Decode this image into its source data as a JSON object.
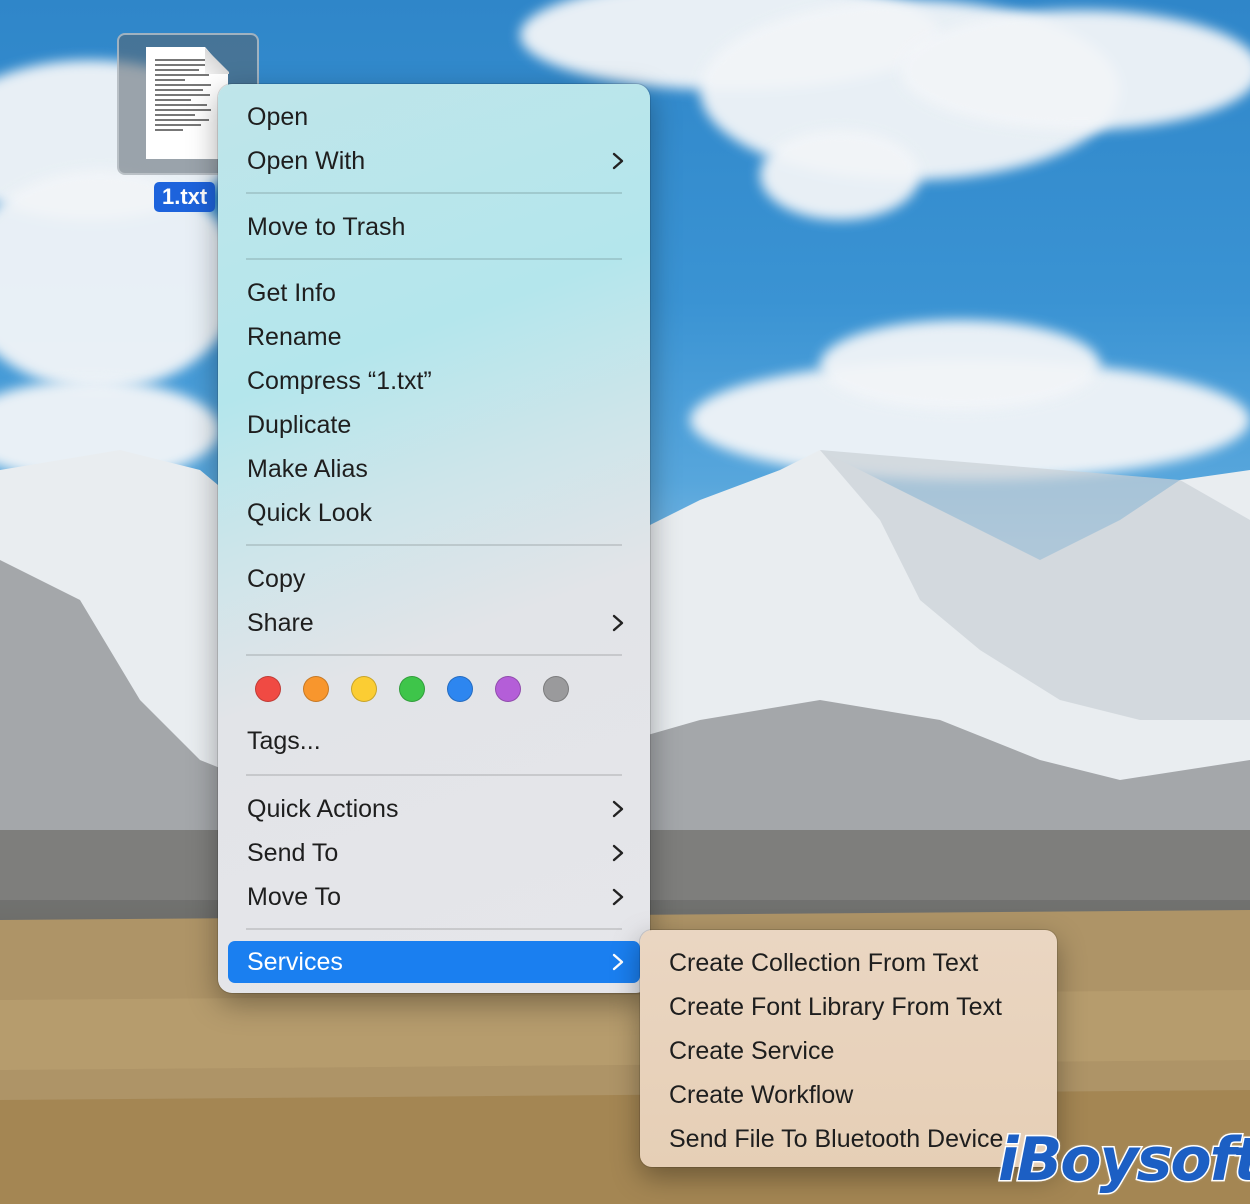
{
  "desktop": {
    "file": {
      "name": "1.txt",
      "icon": "text-document-icon"
    }
  },
  "context_menu": {
    "open": "Open",
    "open_with": "Open With",
    "move_to_trash": "Move to Trash",
    "get_info": "Get Info",
    "rename": "Rename",
    "compress": "Compress “1.txt”",
    "duplicate": "Duplicate",
    "make_alias": "Make Alias",
    "quick_look": "Quick Look",
    "copy": "Copy",
    "share": "Share",
    "tag_colors": [
      "#f04a43",
      "#f8962d",
      "#fbcd33",
      "#3ec54a",
      "#2d86f0",
      "#b45ed8",
      "#9a9a9c"
    ],
    "tags": "Tags...",
    "quick_actions": "Quick Actions",
    "send_to": "Send To",
    "move_to": "Move To",
    "services": "Services"
  },
  "services_submenu": {
    "items": [
      "Create Collection From Text",
      "Create Font Library From Text",
      "Create Service",
      "Create Workflow",
      "Send File To Bluetooth Device"
    ]
  },
  "watermark": {
    "text": "iBoysoft"
  },
  "colors": {
    "highlight": "#1a7ff0",
    "file_label_bg": "#1d63dc"
  }
}
